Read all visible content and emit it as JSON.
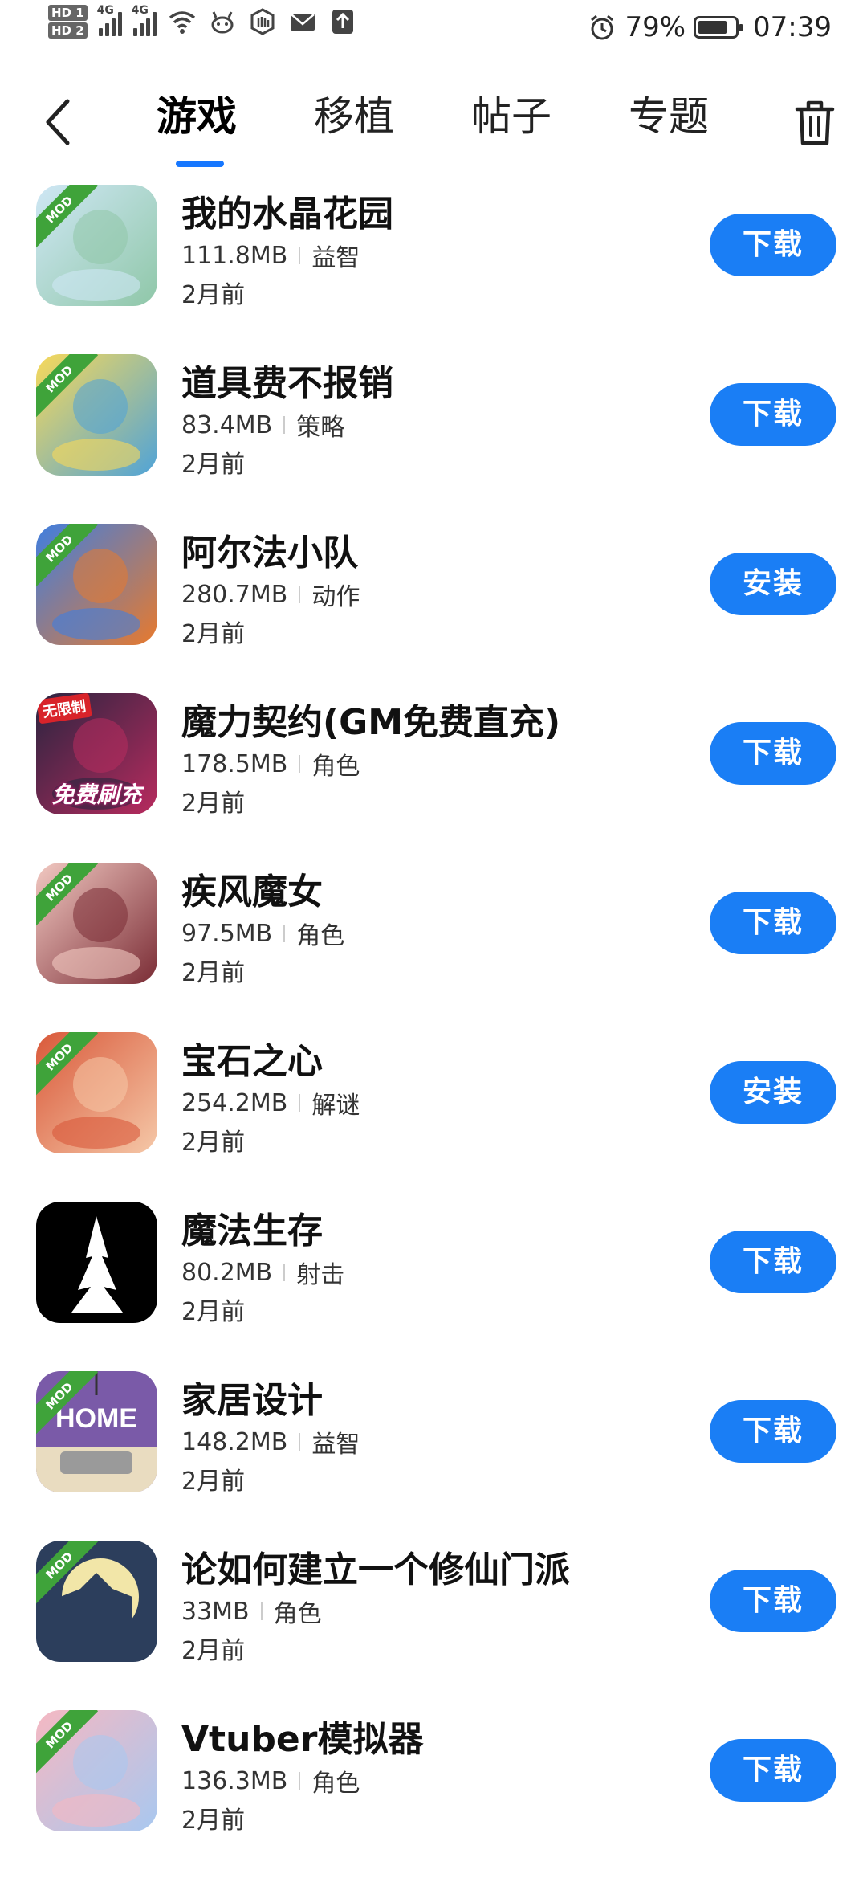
{
  "status": {
    "hd1": "HD 1",
    "hd2": "HD 2",
    "net1": "4G",
    "net2": "4G",
    "battery_percent_label": "79%",
    "battery_level": 0.79,
    "time": "07:39"
  },
  "nav": {
    "tabs": [
      {
        "label": "游戏"
      },
      {
        "label": "移植"
      },
      {
        "label": "帖子"
      },
      {
        "label": "专题"
      }
    ]
  },
  "apps": [
    {
      "name": "我的水晶花园",
      "size": "111.8MB",
      "category": "益智",
      "date": "2月前",
      "action": "下载",
      "badge": "MOD",
      "icon_colors": [
        "#cfe7f5",
        "#8fc7a8"
      ]
    },
    {
      "name": "道具费不报销",
      "size": "83.4MB",
      "category": "策略",
      "date": "2月前",
      "action": "下载",
      "badge": "MOD",
      "icon_colors": [
        "#f8d95a",
        "#4fa3d8"
      ]
    },
    {
      "name": "阿尔法小队",
      "size": "280.7MB",
      "category": "动作",
      "date": "2月前",
      "action": "安装",
      "badge": "MOD",
      "icon_colors": [
        "#3f7ee0",
        "#e87a2d"
      ]
    },
    {
      "name": "魔力契约(GM免费直充)",
      "size": "178.5MB",
      "category": "角色",
      "date": "2月前",
      "action": "下载",
      "badge": "无限制",
      "badge_bottom": "免费刷充",
      "icon_colors": [
        "#2a2440",
        "#b82b5e"
      ]
    },
    {
      "name": "疾风魔女",
      "size": "97.5MB",
      "category": "角色",
      "date": "2月前",
      "action": "下载",
      "badge": "MOD",
      "icon_colors": [
        "#f2c9c2",
        "#7a2c35"
      ]
    },
    {
      "name": "宝石之心",
      "size": "254.2MB",
      "category": "解谜",
      "date": "2月前",
      "action": "安装",
      "badge": "MOD",
      "icon_colors": [
        "#d9593a",
        "#f5c8a8"
      ]
    },
    {
      "name": "魔法生存",
      "size": "80.2MB",
      "category": "射击",
      "date": "2月前",
      "action": "下载",
      "badge": "",
      "icon_colors": [
        "#000000",
        "#ffffff"
      ]
    },
    {
      "name": "家居设计",
      "size": "148.2MB",
      "category": "益智",
      "date": "2月前",
      "action": "下载",
      "badge": "MOD",
      "icon_colors": [
        "#7a5aa8",
        "#e9dcc0"
      ]
    },
    {
      "name": "论如何建立一个修仙门派",
      "size": "33MB",
      "category": "角色",
      "date": "2月前",
      "action": "下载",
      "badge": "MOD",
      "icon_colors": [
        "#2c3e5c",
        "#f2e6a8"
      ]
    },
    {
      "name": "Vtuber模拟器",
      "size": "136.3MB",
      "category": "角色",
      "date": "2月前",
      "action": "下载",
      "badge": "MOD",
      "icon_colors": [
        "#f5b8c2",
        "#a8c8f0"
      ]
    }
  ],
  "home_icon_text": "HOME",
  "accent_color": "#1a7ef5"
}
